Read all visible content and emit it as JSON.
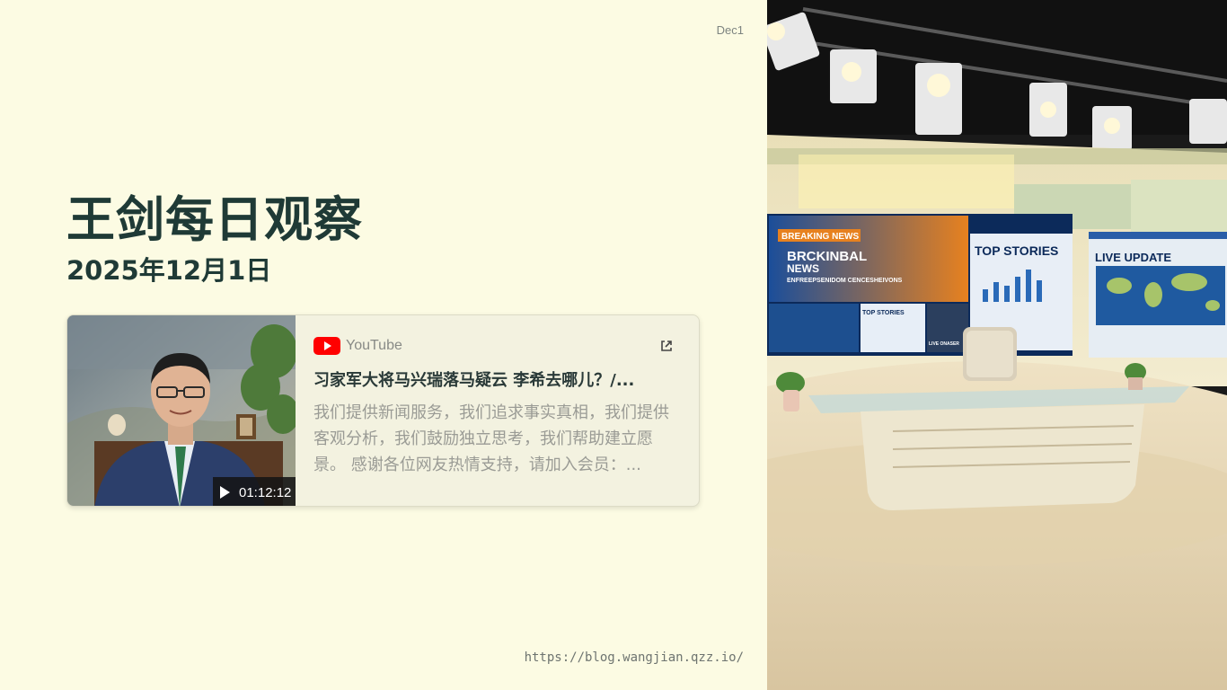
{
  "slide": {
    "label": "Dec1",
    "title": "王剑每日观察",
    "subtitle": "2025年12月1日",
    "url": "https://blog.wangjian.qzz.io/"
  },
  "video_card": {
    "source": "YouTube",
    "title": "习家军大将马兴瑞落马疑云 李希去哪儿？/...",
    "description": "我们提供新闻服务，我们追求事实真相，我们提供客观分析，我们鼓励独立思考，我们帮助建立愿景。 感谢各位网友热情支持，请加入会员：...",
    "duration": "01:12:12",
    "icons": [
      "youtube-logo-icon",
      "external-link-icon",
      "play-icon"
    ]
  },
  "studio_image": {
    "screen_texts": {
      "breaking_tag": "BREAKING NEWS",
      "headline_1": "BRCKINBAL",
      "headline_2": "NEWS",
      "headline_3": "ENFREEPSENIDOM CENCESHEIVONS",
      "top_stories": "TOP STORIES",
      "small_top_stories": "TOP STORIES",
      "live_update": "LIVE UPDATE",
      "live_onaser": "LIVE ONASER"
    }
  },
  "colors": {
    "background": "#fcfbe3",
    "title": "#1f3a36",
    "youtube_red": "#ff0000"
  }
}
